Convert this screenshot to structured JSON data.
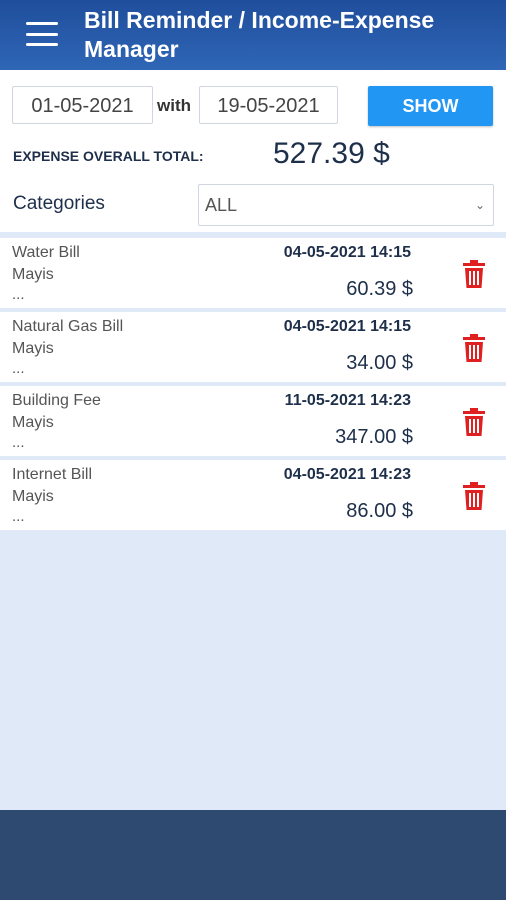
{
  "app_bar": {
    "title": "Bill Reminder / Income-Expense Manager"
  },
  "filter": {
    "date_from": "01-05-2021",
    "with_label": "with",
    "date_to": "19-05-2021",
    "show_label": "SHOW",
    "total_label": "EXPENSE OVERALL TOTAL:",
    "total_value": "527.39 $",
    "categories_label": "Categories",
    "category_selected": "ALL"
  },
  "expenses": [
    {
      "name": "Water Bill",
      "month": "Mayis",
      "more": "...",
      "datetime": "04-05-2021 14:15",
      "amount": "60.39 $"
    },
    {
      "name": "Natural Gas Bill",
      "month": "Mayis",
      "more": "...",
      "datetime": "04-05-2021 14:15",
      "amount": "34.00 $"
    },
    {
      "name": "Building Fee",
      "month": "Mayis",
      "more": "...",
      "datetime": "11-05-2021 14:23",
      "amount": "347.00 $"
    },
    {
      "name": "Internet Bill",
      "month": "Mayis",
      "more": "...",
      "datetime": "04-05-2021 14:23",
      "amount": "86.00 $"
    }
  ],
  "icons": {
    "menu": "hamburger-menu-icon",
    "delete": "trash-icon",
    "dropdown": "chevron-down-icon"
  },
  "colors": {
    "app_bar": "#2a5aa8",
    "show_button": "#2196f3",
    "delete_icon": "#e02020",
    "background": "#dfe9f7",
    "bottom_bar": "#2e4a70"
  }
}
